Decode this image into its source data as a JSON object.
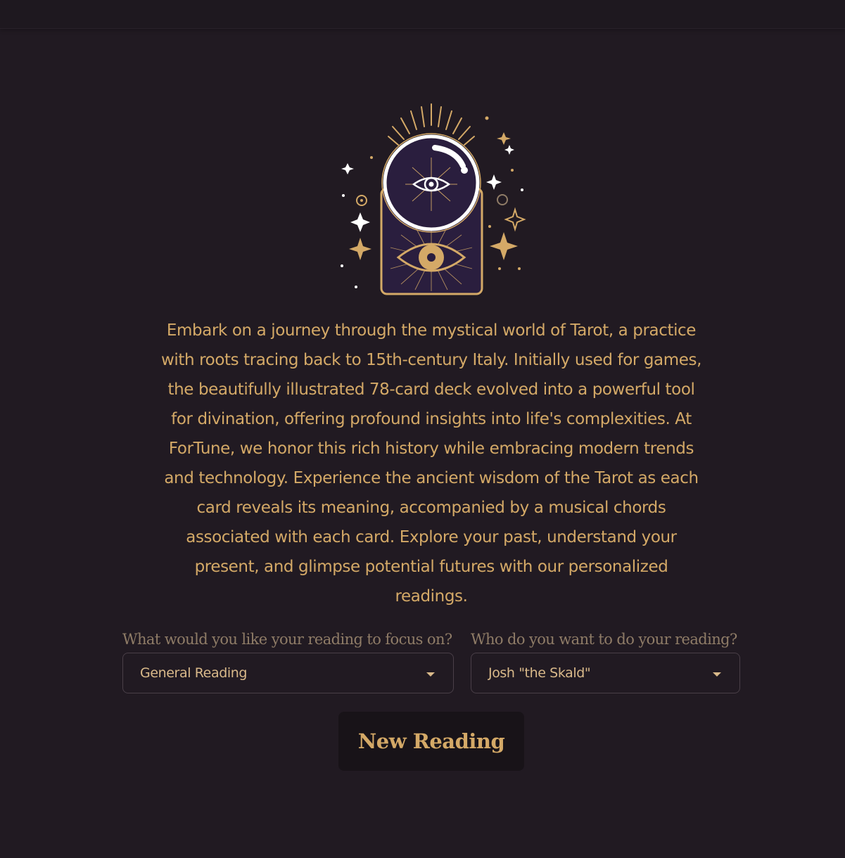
{
  "intro": {
    "text": "Embark on a journey through the mystical world of Tarot, a practice with roots tracing back to 15th-century Italy. Initially used for games, the beautifully illustrated 78-card deck evolved into a powerful tool for divination, offering profound insights into life's complexities. At ForTune, we honor this rich history while embracing modern trends and technology. Experience the ancient wisdom of the Tarot as each card reveals its meaning, accompanied by a musical chords associated with each card. Explore your past, understand your present, and glimpse potential futures with our personalized readings."
  },
  "focus": {
    "label": "What would you like your reading to focus on?",
    "selected": "General Reading"
  },
  "reader": {
    "label": "Who do you want to do your reading?",
    "selected": "Josh \"the Skald\""
  },
  "actions": {
    "new_reading_label": "New Reading"
  },
  "colors": {
    "background": "#211a22",
    "accent_gold": "#d4a967",
    "label_muted": "#8f7c67",
    "orb_purple": "#2a1e3e"
  },
  "icons": {
    "logo": "tarot-card-crystal-ball-eye-logo"
  }
}
